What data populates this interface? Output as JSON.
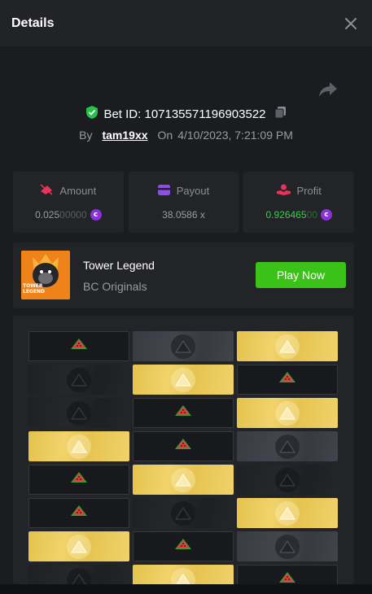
{
  "header": {
    "title": "Details"
  },
  "bet": {
    "id_text": "Bet ID: 107135571196903522",
    "by_label": "By",
    "username": "tam19xx",
    "on_label": "On",
    "timestamp": "4/10/2023, 7:21:09 PM"
  },
  "stats": {
    "amount": {
      "label": "Amount",
      "value_main": "0.025",
      "value_dim": "00000"
    },
    "payout": {
      "label": "Payout",
      "value": "38.0586 x"
    },
    "profit": {
      "label": "Profit",
      "value_main": "0.926465",
      "value_dim": "00"
    }
  },
  "coin_symbol": "c",
  "game": {
    "name": "Tower Legend",
    "provider": "BC Originals",
    "play_label": "Play Now",
    "thumb_text": "TOWER\nLEGEND"
  },
  "board": {
    "rows": [
      [
        "melon",
        "grey",
        "gold"
      ],
      [
        "dark",
        "gold",
        "melon"
      ],
      [
        "dark",
        "melon",
        "gold"
      ],
      [
        "gold",
        "melon",
        "grey"
      ],
      [
        "melon",
        "gold",
        "dark"
      ],
      [
        "melon",
        "dark",
        "gold"
      ],
      [
        "gold",
        "melon",
        "grey"
      ],
      [
        "dark",
        "gold",
        "melon"
      ]
    ]
  },
  "colors": {
    "accent_green": "#3bc117",
    "profit_green": "#33d043",
    "coin_purple": "#8a32d9",
    "shield_green": "#24c24a",
    "melon_red": "#e83a3a"
  }
}
